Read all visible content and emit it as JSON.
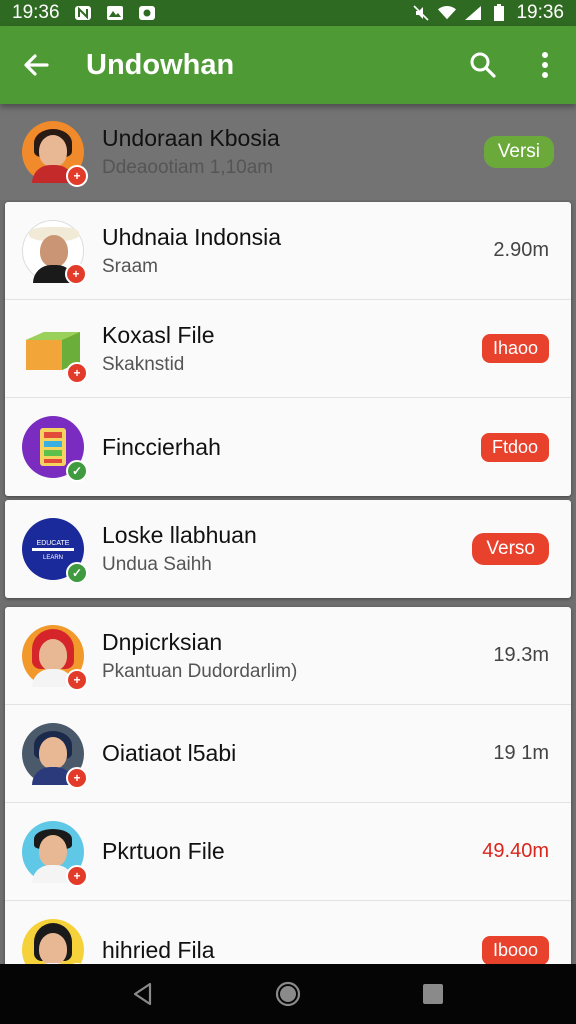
{
  "status_bar": {
    "time_left": "19:36",
    "time_right": "19:36",
    "icons_left": [
      "n-icon",
      "gallery-icon",
      "app-icon"
    ],
    "icons_right": [
      "mute-icon",
      "wifi-icon",
      "signal-icon",
      "battery-icon"
    ]
  },
  "app_bar": {
    "title": "Undowhan",
    "back_icon": "arrow-left-icon",
    "search_icon": "search-icon",
    "menu_icon": "more-vert-icon"
  },
  "header_item": {
    "name": "Undoraan Kbosia",
    "subtitle": "Ddeaootiam 1,10am",
    "badge": "Versi"
  },
  "cards": [
    {
      "items": [
        {
          "name": "Uhdnaia Indonsia",
          "subtitle": "Sraam",
          "meta": "2.90m",
          "avatar": "man-hat",
          "status": "red"
        },
        {
          "name": "Koxasl File",
          "subtitle": "Skaknstid",
          "badge": "Ihaoo",
          "avatar": "folder",
          "status": "red"
        },
        {
          "name": "Finccierhah",
          "subtitle": "",
          "badge": "Ftdoo",
          "avatar": "abacus",
          "status": "green"
        }
      ]
    },
    {
      "items": [
        {
          "name": "Loske llabhuan",
          "subtitle": "Undua Saihh",
          "badge": "Verso",
          "avatar": "logo",
          "status": "green"
        }
      ]
    },
    {
      "items": [
        {
          "name": "Dnpicrksian",
          "subtitle": "Pkantuan Dudordarlim)",
          "meta": "19.3m",
          "avatar": "woman-hijab",
          "status": "red"
        },
        {
          "name": "Oiatiaot l5abi",
          "subtitle": "",
          "meta": "19 1m",
          "avatar": "man-cap",
          "status": "red"
        },
        {
          "name": "Pkrtuon File",
          "subtitle": "",
          "meta": "49.40m",
          "meta_red": true,
          "avatar": "man-smile",
          "status": "red"
        },
        {
          "name": "hihried Fila",
          "subtitle": "",
          "badge": "Ibooo",
          "avatar": "woman-yellow",
          "status": "red"
        }
      ]
    }
  ],
  "nav_bar": {
    "back": "nav-back-icon",
    "home": "nav-home-icon",
    "recents": "nav-recents-icon"
  },
  "colors": {
    "status_bar": "#2f6a22",
    "app_bar": "#4e9a35",
    "badge_red": "#e8412c",
    "badge_green": "#6aa93a"
  }
}
